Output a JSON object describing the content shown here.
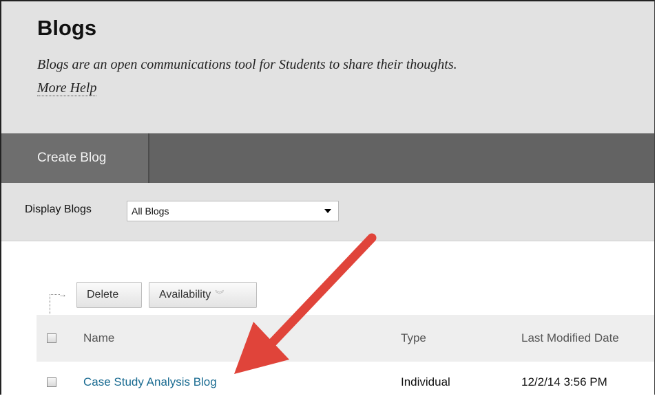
{
  "header": {
    "title": "Blogs",
    "description": "Blogs are an open communications tool for Students to share their thoughts.",
    "help_link": "More Help"
  },
  "actionbar": {
    "create_label": "Create Blog"
  },
  "filter": {
    "label": "Display Blogs",
    "selected": "All Blogs"
  },
  "toolbar": {
    "delete_label": "Delete",
    "availability_label": "Availability"
  },
  "table": {
    "columns": [
      "Name",
      "Type",
      "Last Modified Date"
    ],
    "rows": [
      {
        "name": "Case Study Analysis Blog",
        "type": "Individual",
        "modified": "12/2/14 3:56 PM"
      }
    ]
  },
  "annotation": {
    "color": "#e0443a"
  },
  "icons": [
    "tree-arrow-icon",
    "chevron-double-down-icon",
    "dropdown-caret-icon",
    "checkbox-icon"
  ]
}
